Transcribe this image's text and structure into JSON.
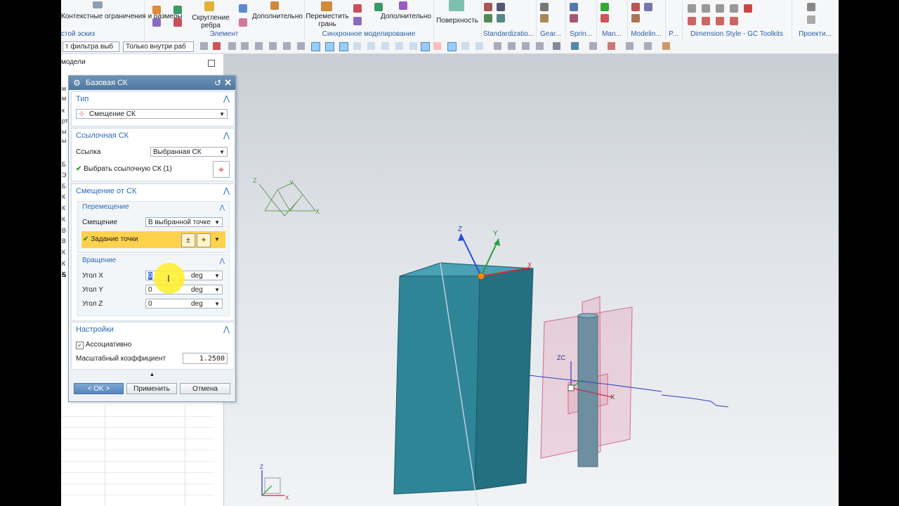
{
  "ribbon": {
    "groups": [
      {
        "label": "стой эскиз",
        "buttons": [
          "Контекстные ограничения и размеры"
        ]
      },
      {
        "label": "Элемент",
        "buttons": [
          "Скругление ребра",
          "Дополнительно"
        ]
      },
      {
        "label": "Синхронное моделирование",
        "buttons": [
          "Переместить грань",
          "Дополнительно"
        ]
      },
      {
        "label": "",
        "buttons": [
          "Поверхность"
        ]
      },
      {
        "label": "Standardizatio..."
      },
      {
        "label": "Gear..."
      },
      {
        "label": "Sprin..."
      },
      {
        "label": "Man..."
      },
      {
        "label": "Modelin..."
      },
      {
        "label": "P..."
      },
      {
        "label": "Dimension Style - GC Toolkits"
      },
      {
        "label": "Проекти..."
      }
    ]
  },
  "selection_bar": {
    "filter": "т фильтра выб",
    "scope": "Только внутри раб"
  },
  "navigator": {
    "title": "модели",
    "letters": [
      "м",
      "м",
      "к",
      "рт",
      "ы",
      "ы",
      "Б",
      "Э",
      "Б",
      "К",
      "К",
      "К",
      "В",
      "В",
      "К",
      "К",
      "К",
      "Б"
    ]
  },
  "dialog": {
    "title": "Базовая СК",
    "type_section": {
      "title": "Тип",
      "value": "Смещение СК"
    },
    "ref_section": {
      "title": "Ссылочная СК",
      "ref_label": "Ссылка",
      "ref_value": "Выбранная СК",
      "select_label": "Выбрать ссылочную СК (1)"
    },
    "offset_section": {
      "title": "Смещение от СК",
      "move": {
        "title": "Перемещение",
        "offset_label": "Смещение",
        "offset_value": "В выбранной точке",
        "point_label": "Задание точки"
      },
      "rotate": {
        "title": "Вращение",
        "rows": [
          {
            "label": "Угол X",
            "value": "0",
            "unit": "deg"
          },
          {
            "label": "Угол Y",
            "value": "0",
            "unit": "deg"
          },
          {
            "label": "Угол Z",
            "value": "0",
            "unit": "deg"
          }
        ]
      }
    },
    "settings_section": {
      "title": "Настройки",
      "assoc_label": "Ассоциативно",
      "scale_label": "Масштабный коэффициент",
      "scale_value": "1.2500"
    },
    "buttons": {
      "ok": "< OK >",
      "apply": "Применить",
      "cancel": "Отмена"
    }
  },
  "viewport": {
    "axes": {
      "x": "X",
      "y": "Y",
      "z": "Z",
      "zc": "ZC"
    }
  },
  "colors": {
    "body": "#2e7e93",
    "highlight": "#ffd24d",
    "accent": "#2a6bb5"
  }
}
